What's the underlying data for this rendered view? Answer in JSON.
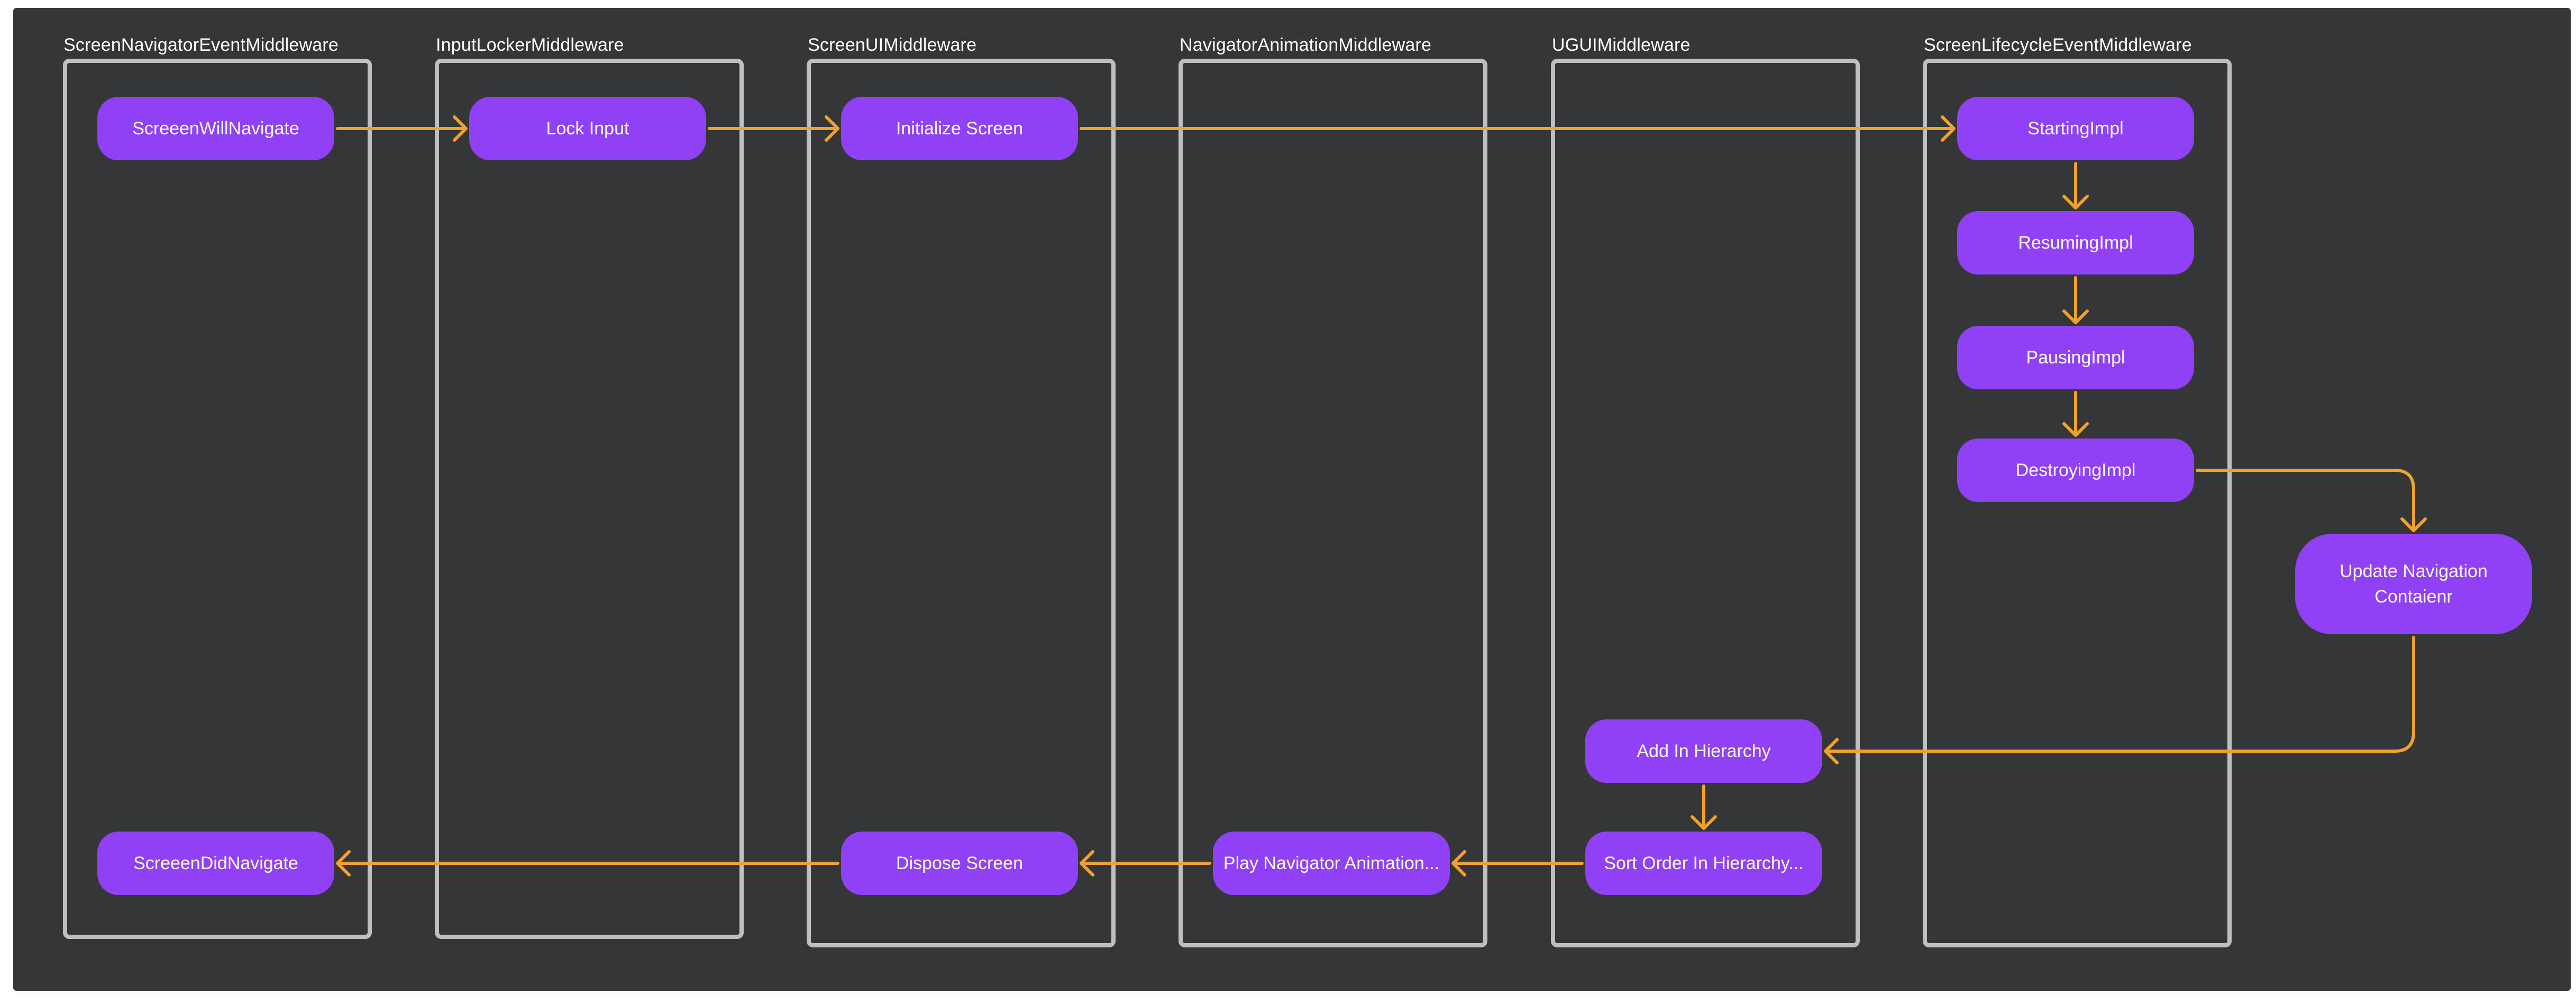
{
  "lanes": [
    {
      "id": "screen-navigator-event",
      "title": "ScreenNavigatorEventMiddleware"
    },
    {
      "id": "input-locker",
      "title": "InputLockerMiddleware"
    },
    {
      "id": "screen-ui",
      "title": "ScreenUIMiddleware"
    },
    {
      "id": "navigator-animation",
      "title": "NavigatorAnimationMiddleware"
    },
    {
      "id": "ugui",
      "title": "UGUIMiddleware"
    },
    {
      "id": "screen-lifecycle-event",
      "title": "ScreenLifecycleEventMiddleware"
    }
  ],
  "nodes": {
    "screen_will_navigate": "ScreeenWillNavigate",
    "lock_input": "Lock Input",
    "initialize_screen": "Initialize Screen",
    "starting_impl": "StartingImpl",
    "resuming_impl": "ResumingImpl",
    "pausing_impl": "PausingImpl",
    "destroying_impl": "DestroyingImpl",
    "update_navigation_container": "Update Navigation\nContaienr",
    "add_in_hierarchy": "Add In Hierarchy",
    "sort_order_in_hierarchy": "Sort Order In Hierarchy...",
    "play_navigator_animation": "Play Navigator Animation...",
    "dispose_screen": "Dispose Screen",
    "screen_did_navigate": "ScreeenDidNavigate"
  },
  "edges": [
    [
      "screen_will_navigate",
      "lock_input"
    ],
    [
      "lock_input",
      "initialize_screen"
    ],
    [
      "initialize_screen",
      "starting_impl"
    ],
    [
      "starting_impl",
      "resuming_impl"
    ],
    [
      "resuming_impl",
      "pausing_impl"
    ],
    [
      "pausing_impl",
      "destroying_impl"
    ],
    [
      "destroying_impl",
      "update_navigation_container"
    ],
    [
      "update_navigation_container",
      "add_in_hierarchy"
    ],
    [
      "add_in_hierarchy",
      "sort_order_in_hierarchy"
    ],
    [
      "sort_order_in_hierarchy",
      "play_navigator_animation"
    ],
    [
      "play_navigator_animation",
      "dispose_screen"
    ],
    [
      "dispose_screen",
      "screen_did_navigate"
    ]
  ],
  "colors": {
    "background": "#353638",
    "lane_border": "#bfbfbf",
    "node_fill": "#9141f5",
    "arrow": "#f2a22c",
    "text": "#ffffff"
  }
}
